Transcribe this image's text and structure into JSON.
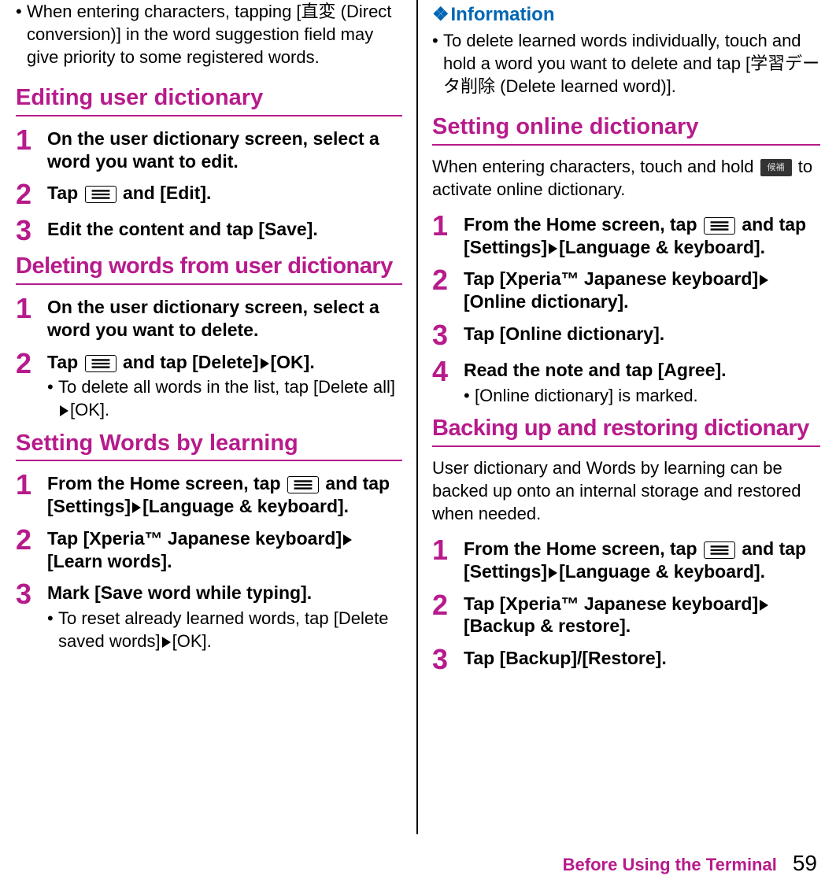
{
  "left": {
    "intro_note": "When entering characters, tapping [直変 (Direct conversion)] in the word suggestion field may give priority to some registered words.",
    "editing": {
      "heading": "Editing user dictionary",
      "step1": "On the user dictionary screen, select a word you want to edit.",
      "step2_pre": "Tap ",
      "step2_post": " and [Edit].",
      "step3": "Edit the content and tap [Save]."
    },
    "deleting": {
      "heading": "Deleting words from user dictionary",
      "step1": "On the user dictionary screen, select a word you want to delete.",
      "step2_pre": "Tap ",
      "step2_mid": " and tap [Delete]",
      "step2_post": "[OK].",
      "step2_note_pre": "To delete all words in the list, tap [Delete all]",
      "step2_note_post": "[OK]."
    },
    "learning": {
      "heading": "Setting Words by learning",
      "step1_pre": "From the Home screen, tap ",
      "step1_mid": " and tap [Settings]",
      "step1_post": "[Language & keyboard].",
      "step2_pre": "Tap [Xperia™ Japanese keyboard]",
      "step2_post": "[Learn words].",
      "step3": "Mark [Save word while typing].",
      "step3_note_pre": "To reset already learned words, tap [Delete saved words]",
      "step3_note_post": "[OK]."
    }
  },
  "right": {
    "info": {
      "heading": "Information",
      "note": "To delete learned words individually, touch and hold a word you want to delete and tap [学習データ削除 (Delete learned word)]."
    },
    "online": {
      "heading": "Setting online dictionary",
      "intro_pre": "When entering characters, touch and hold ",
      "intro_post": " to activate online dictionary.",
      "step1_pre": "From the Home screen, tap ",
      "step1_mid": " and tap [Settings]",
      "step1_post": "[Language & keyboard].",
      "step2_pre": "Tap [Xperia™ Japanese keyboard]",
      "step2_post": "[Online dictionary].",
      "step3": "Tap [Online dictionary].",
      "step4": "Read the note and tap [Agree].",
      "step4_note": "[Online dictionary] is marked."
    },
    "backup": {
      "heading": "Backing up and restoring dictionary",
      "intro": "User dictionary and Words by learning can be backed up onto an internal storage and restored when needed.",
      "step1_pre": "From the Home screen, tap ",
      "step1_mid": " and tap [Settings]",
      "step1_post": "[Language & keyboard].",
      "step2_pre": "Tap [Xperia™ Japanese keyboard]",
      "step2_post": "[Backup & restore].",
      "step3": "Tap [Backup]/[Restore]."
    }
  },
  "footer": {
    "label": "Before Using the Terminal",
    "page": "59"
  },
  "icons": {
    "option_label": "候補"
  }
}
